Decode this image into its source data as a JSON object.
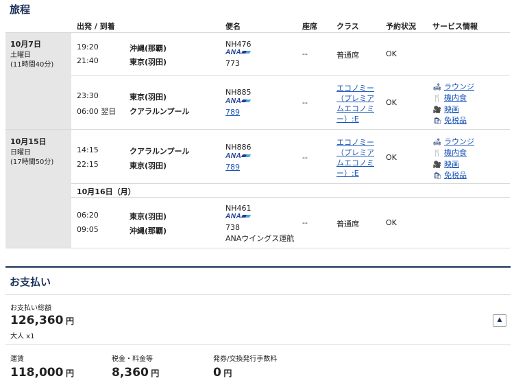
{
  "itinerary": {
    "title": "旅程",
    "headers": {
      "dep_arr": "出発 / 到着",
      "flight": "便名",
      "seat": "座席",
      "class": "クラス",
      "status": "予約状況",
      "services": "サービス情報"
    },
    "days": [
      {
        "date": "10月7日",
        "weekday": "土曜日",
        "duration": "(11時間40分)"
      },
      {
        "date": "10月15日",
        "weekday": "日曜日",
        "duration": "(17時間50分)"
      }
    ],
    "sub_date": "10月16日（月）",
    "flights": [
      {
        "dep_time": "19:20",
        "dep_city": "沖縄(那覇)",
        "arr_time": "21:40",
        "arr_city": "東京(羽田)",
        "flight_no": "NH476",
        "airline_logo": "ANA",
        "aircraft": "773",
        "seat": "--",
        "class": "普通席",
        "status": "OK"
      },
      {
        "dep_time": "23:30",
        "dep_city": "東京(羽田)",
        "arr_time": "06:00 翌日",
        "arr_city": "クアラルンプール",
        "flight_no": "NH885",
        "airline_logo": "ANA",
        "aircraft": "789",
        "seat": "--",
        "class_lines": [
          "エコノミー",
          "（プレミア",
          "ムエコノミ",
          "ー）:E"
        ],
        "status": "OK"
      },
      {
        "dep_time": "14:15",
        "dep_city": "クアラルンプール",
        "arr_time": "22:15",
        "arr_city": "東京(羽田)",
        "flight_no": "NH886",
        "airline_logo": "ANA",
        "aircraft": "789",
        "seat": "--",
        "class_lines": [
          "エコノミー",
          "（プレミア",
          "ムエコノミ",
          "ー）:E"
        ],
        "status": "OK"
      },
      {
        "dep_time": "06:20",
        "dep_city": "東京(羽田)",
        "arr_time": "09:05",
        "arr_city": "沖縄(那覇)",
        "flight_no": "NH461",
        "airline_logo": "ANA",
        "aircraft": "738",
        "operator": "ANAウイングス運航",
        "seat": "--",
        "class": "普通席",
        "status": "OK"
      }
    ],
    "services": [
      {
        "icon": "lounge-icon",
        "label": "ラウンジ"
      },
      {
        "icon": "meal-icon",
        "label": "機内食"
      },
      {
        "icon": "movie-icon",
        "label": "映画"
      },
      {
        "icon": "duty-free-icon",
        "label": "免税品"
      }
    ]
  },
  "payment": {
    "title": "お支払い",
    "total_label": "お支払い総額",
    "total_value": "126,360",
    "total_unit": "円",
    "pax": "大人 x1",
    "toggle_icon": "caret-up-icon",
    "fare_label": "運賃",
    "fare_value": "118,000",
    "tax_label": "税金・料金等",
    "tax_value": "8,360",
    "fee_label": "発券/交換発行手数料",
    "fee_value": "0",
    "unit": "円"
  },
  "colors": {
    "navy": "#1b2f5a",
    "link": "#1a56b8",
    "gray_block": "#e6e6e6"
  }
}
